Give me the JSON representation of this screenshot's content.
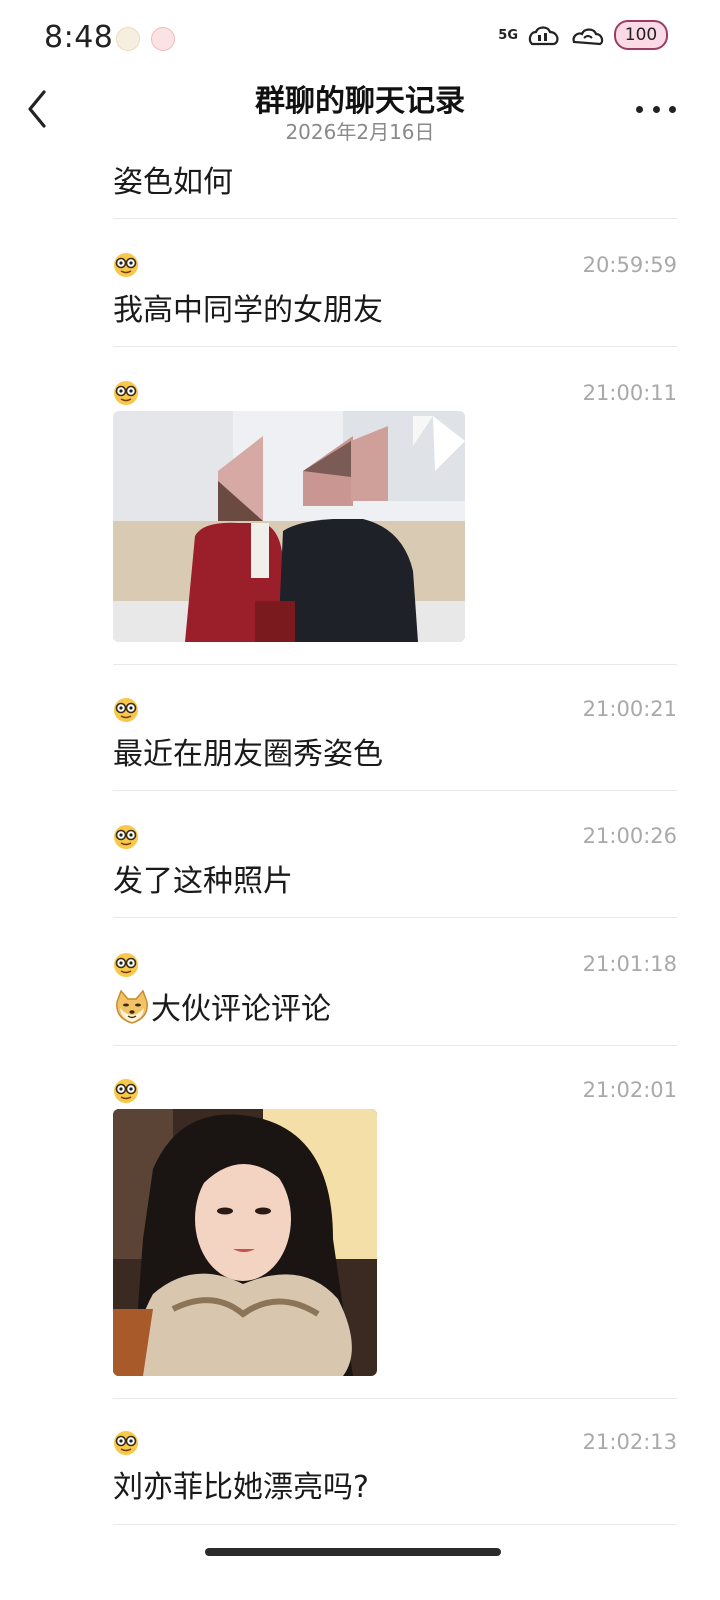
{
  "status_bar": {
    "time": "8:48",
    "signal": "5G",
    "battery": "100"
  },
  "header": {
    "title": "群聊的聊天记录",
    "date": "2026年2月16日"
  },
  "messages": [
    {
      "text": "姿色如何"
    },
    {
      "time": "20:59:59",
      "text": "我高中同学的女朋友"
    },
    {
      "time": "21:00:11",
      "image": "couple-photo-pixelated-faces"
    },
    {
      "time": "21:00:21",
      "text": "最近在朋友圈秀姿色"
    },
    {
      "time": "21:00:26",
      "text": "发了这种照片"
    },
    {
      "time": "21:01:18",
      "text": "大伙评论评论",
      "inline_emoji": "doge-emoji"
    },
    {
      "time": "21:02:01",
      "image": "woman-fur-collar-photo"
    },
    {
      "time": "21:02:13",
      "text": "刘亦菲比她漂亮吗?"
    }
  ],
  "colors": {
    "timestamp": "#a9a9a9",
    "divider": "#e8e8e8",
    "text": "#1a1a1a"
  }
}
